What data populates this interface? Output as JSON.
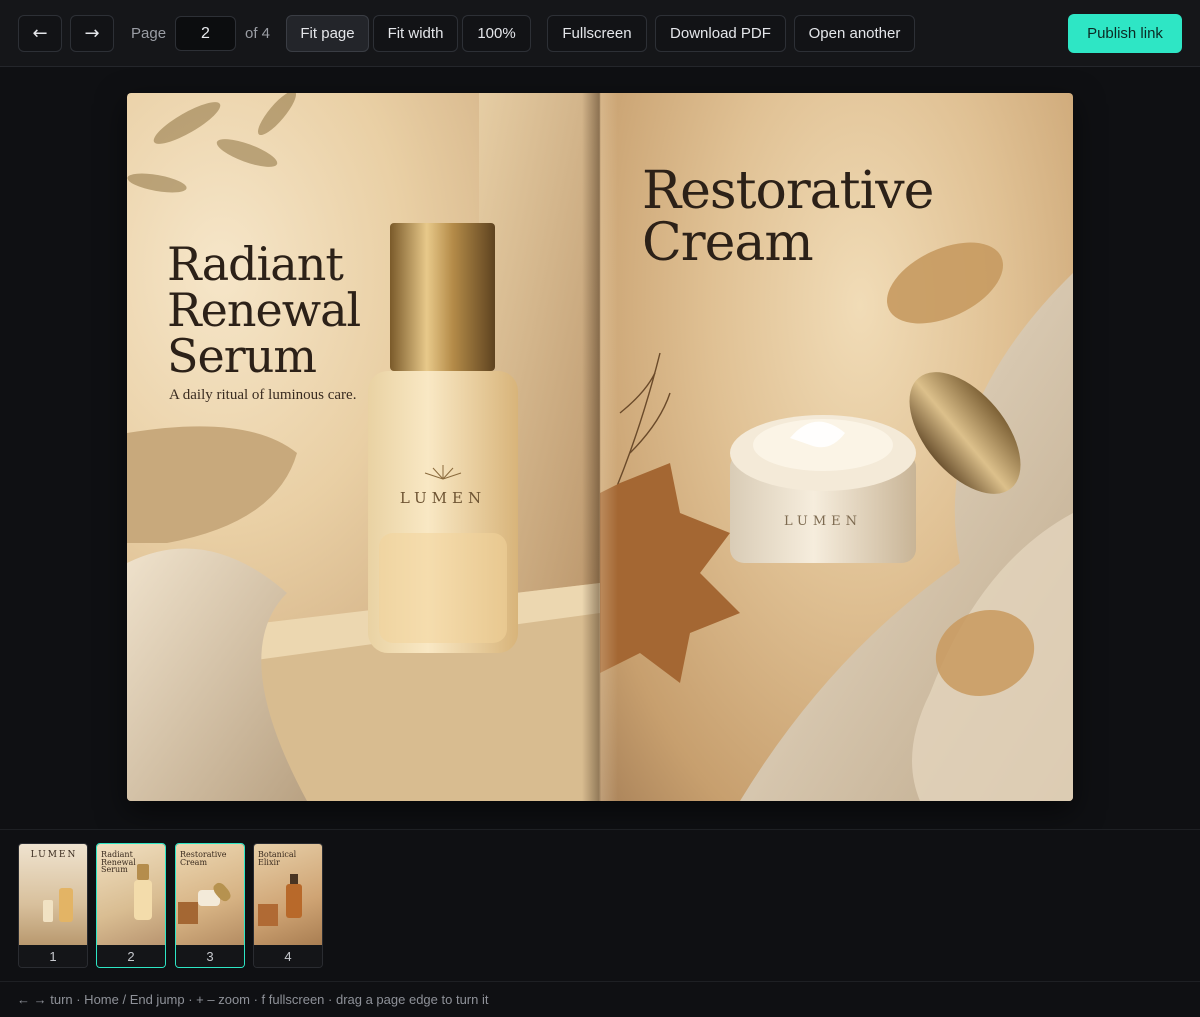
{
  "toolbar": {
    "prev_label": "←",
    "next_label": "→",
    "page_label": "Page",
    "page_value": "2",
    "of_label": "of 4",
    "fit_page_label": "Fit page",
    "fit_width_label": "Fit width",
    "zoom_label": "100%",
    "fullscreen_label": "Fullscreen",
    "download_label": "Download PDF",
    "open_label": "Open another",
    "publish_label": "Publish link"
  },
  "spread": {
    "left": {
      "title": "Radiant Renewal Serum",
      "subtitle": "A daily ritual of luminous care.",
      "brand": "LUMEN"
    },
    "right": {
      "title": "Restorative Cream",
      "brand": "LUMEN"
    }
  },
  "thumbnails": [
    {
      "number": "1",
      "title": "LUMEN",
      "selected": false
    },
    {
      "number": "2",
      "title": "Radiant Renewal Serum",
      "selected": true
    },
    {
      "number": "3",
      "title": "Restorative Cream",
      "selected": true
    },
    {
      "number": "4",
      "title": "Botanical Elixir",
      "selected": false
    }
  ],
  "hint": "← → turn · Home / End jump · + – zoom · f fullscreen · drag a page edge to turn it",
  "colors": {
    "accent": "#2ee6c5",
    "background": "#0f1013",
    "toolbar": "#151619"
  }
}
